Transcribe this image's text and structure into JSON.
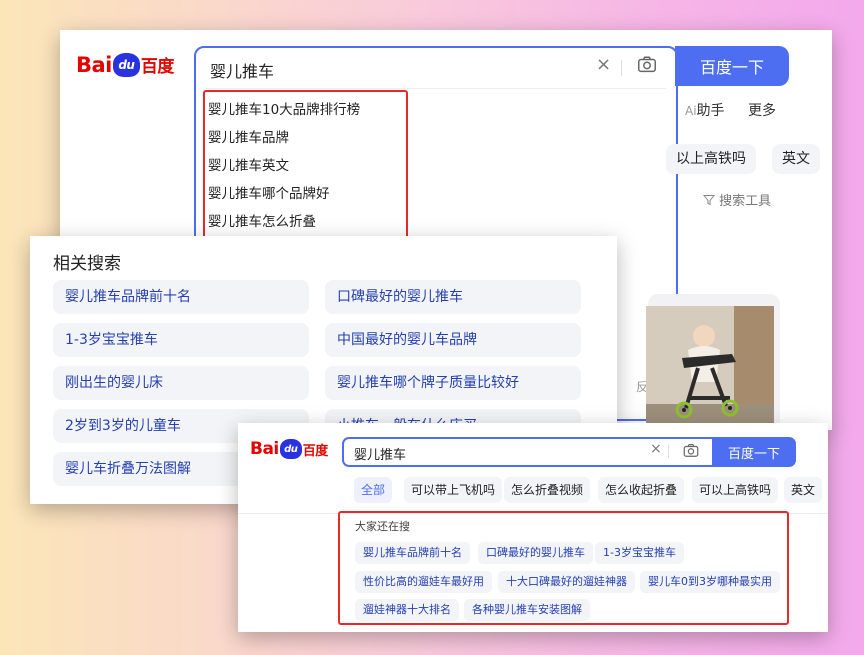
{
  "panel1": {
    "logo": {
      "bai": "Bai",
      "du": "du",
      "cn": "百度"
    },
    "query": "婴儿推车",
    "suggestions": [
      "婴儿推车10大品牌排行榜",
      "婴儿推车品牌",
      "婴儿推车英文",
      "婴儿推车哪个品牌好",
      "婴儿推车怎么折叠"
    ],
    "feedback": "反馈",
    "search_button": "百度一下",
    "ai_prefix": "Ai",
    "ai_help": "助手",
    "more": "更多",
    "chips": [
      "以上高铁吗",
      "英文"
    ],
    "tools": "搜索工具",
    "clear_icon": "×"
  },
  "panel2": {
    "title": "相关搜索",
    "items": [
      "婴儿推车品牌前十名",
      "口碑最好的婴儿推车",
      "1-3岁宝宝推车",
      "中国最好的婴儿车品牌",
      "刚出生的婴儿床",
      "婴儿推车哪个牌子质量比较好",
      "2岁到3岁的儿童车",
      "小推车一般在什么店买",
      "婴儿车折叠万法图解"
    ]
  },
  "panel3": {
    "logo": {
      "bai": "Bai",
      "du": "du",
      "cn": "百度"
    },
    "query": "婴儿推车",
    "search_button": "百度一下",
    "clear_icon": "×",
    "tabs": [
      "全部",
      "可以带上飞机吗",
      "怎么折叠视频",
      "怎么收起折叠",
      "可以上高铁吗",
      "英文"
    ],
    "also_title": "大家还在搜",
    "also_items": [
      "婴儿推车品牌前十名",
      "口碑最好的婴儿推车",
      "1-3岁宝宝推车",
      "性价比高的遛娃车最好用",
      "十大口碑最好的遛娃神器",
      "婴儿车0到3岁哪种最实用",
      "遛娃神器十大排名",
      "各种婴儿推车安装图解"
    ]
  },
  "colors": {
    "brand_blue": "#4e6ef2",
    "baidu_red": "#e10602",
    "highlight_red": "#e52a2a",
    "link_blue": "#2440b3"
  }
}
